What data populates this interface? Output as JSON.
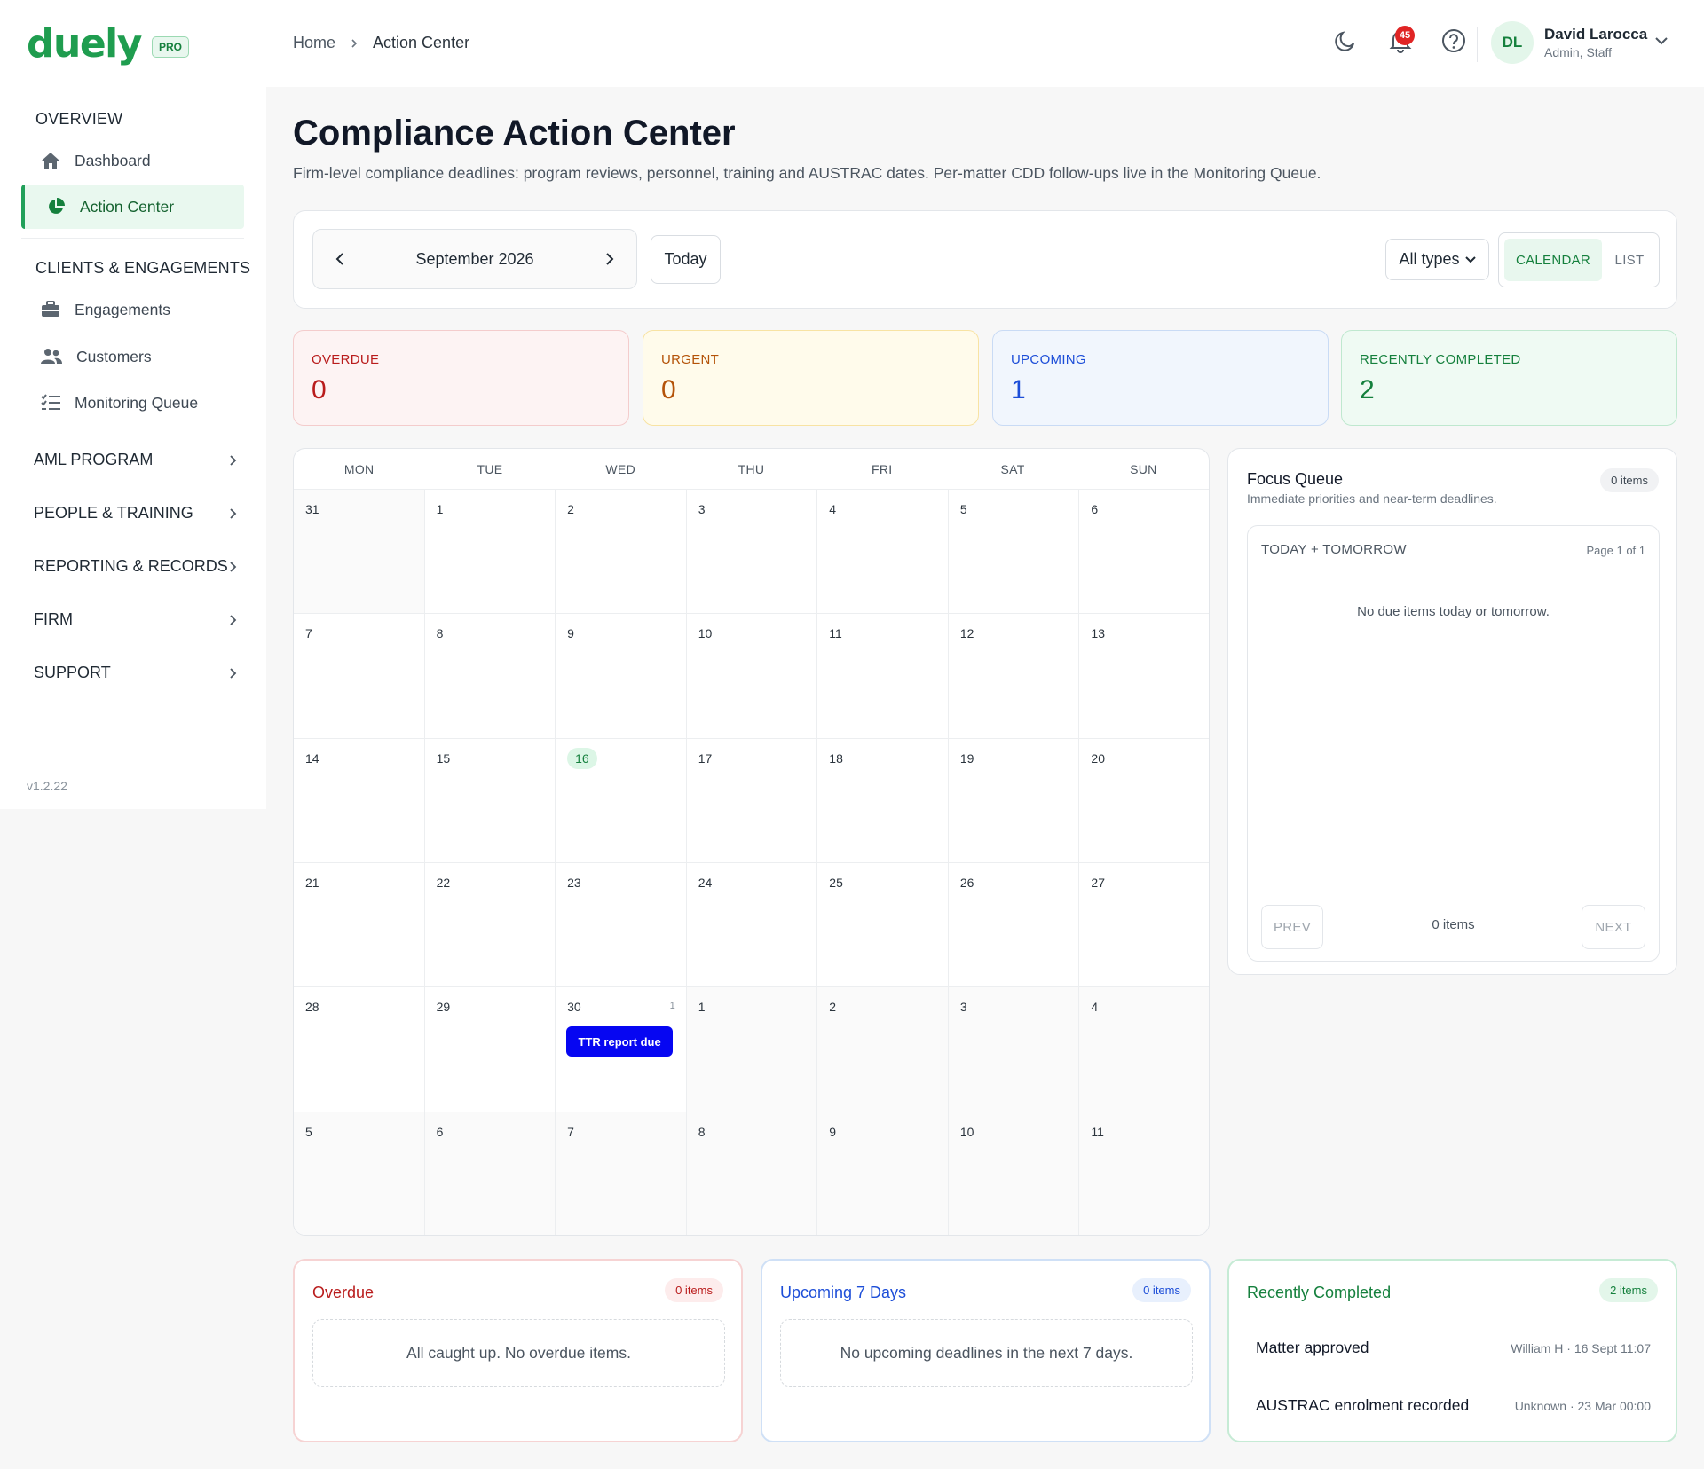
{
  "app": {
    "logo": "duely",
    "plan_badge": "PRO",
    "version": "v1.2.22"
  },
  "sidebar": {
    "overview_title": "OVERVIEW",
    "dashboard": "Dashboard",
    "action_center": "Action Center",
    "clients_title": "CLIENTS & ENGAGEMENTS",
    "engagements": "Engagements",
    "customers": "Customers",
    "monitoring_queue": "Monitoring Queue",
    "groups": [
      "AML PROGRAM",
      "PEOPLE & TRAINING",
      "REPORTING & RECORDS",
      "FIRM",
      "SUPPORT"
    ]
  },
  "header": {
    "breadcrumb_home": "Home",
    "breadcrumb_current": "Action Center",
    "notification_count": "45",
    "user_initials": "DL",
    "user_name": "David Larocca",
    "user_role": "Admin, Staff"
  },
  "page": {
    "title": "Compliance Action Center",
    "subtitle": "Firm-level compliance deadlines: program reviews, personnel, training and AUSTRAC dates. Per-matter CDD follow-ups live in the Monitoring Queue."
  },
  "toolbar": {
    "month_label": "September 2026",
    "today_button": "Today",
    "type_filter": "All types",
    "view_calendar": "CALENDAR",
    "view_list": "LIST"
  },
  "stats": [
    {
      "label": "OVERDUE",
      "value": "0"
    },
    {
      "label": "URGENT",
      "value": "0"
    },
    {
      "label": "UPCOMING",
      "value": "1"
    },
    {
      "label": "RECENTLY COMPLETED",
      "value": "2"
    }
  ],
  "calendar": {
    "weekdays": [
      "MON",
      "TUE",
      "WED",
      "THU",
      "FRI",
      "SAT",
      "SUN"
    ],
    "days": [
      "31",
      "1",
      "2",
      "3",
      "4",
      "5",
      "6",
      "7",
      "8",
      "9",
      "10",
      "11",
      "12",
      "13",
      "14",
      "15",
      "16",
      "17",
      "18",
      "19",
      "20",
      "21",
      "22",
      "23",
      "24",
      "25",
      "26",
      "27",
      "28",
      "29",
      "30",
      "1",
      "2",
      "3",
      "4",
      "5",
      "6",
      "7",
      "8",
      "9",
      "10",
      "11"
    ],
    "today_day": "16",
    "event_day": "30",
    "event_count": "1",
    "event_label": "TTR report due"
  },
  "focus_queue": {
    "title": "Focus Queue",
    "subtitle": "Immediate priorities and near-term deadlines.",
    "count": "0 items",
    "section_title": "TODAY + TOMORROW",
    "page_info": "Page 1 of 1",
    "empty": "No due items today or tomorrow.",
    "prev": "PREV",
    "next": "NEXT",
    "footer_count": "0 items"
  },
  "overdue_card": {
    "title": "Overdue",
    "count": "0 items",
    "empty": "All caught up. No overdue items."
  },
  "upcoming_card": {
    "title": "Upcoming 7 Days",
    "count": "0 items",
    "empty": "No upcoming deadlines in the next 7 days."
  },
  "completed_card": {
    "title": "Recently Completed",
    "count": "2 items",
    "items": [
      {
        "title": "Matter approved",
        "meta": "William H · 16 Sept 11:07"
      },
      {
        "title": "AUSTRAC enrolment recorded",
        "meta": "Unknown · 23 Mar 00:00"
      }
    ]
  },
  "colors": {
    "brand": "#1f9d4f",
    "overdue": "#b91c1c",
    "urgent": "#b45309",
    "upcoming": "#1d4ed8",
    "completed": "#15803d",
    "event": "#0606f2"
  },
  "icons": [
    "home-icon",
    "pie-chart-icon",
    "briefcase-icon",
    "users-icon",
    "list-check-icon",
    "chevron-right-icon",
    "moon-icon",
    "bell-icon",
    "help-icon",
    "chevron-down-icon",
    "chevron-left-icon"
  ]
}
